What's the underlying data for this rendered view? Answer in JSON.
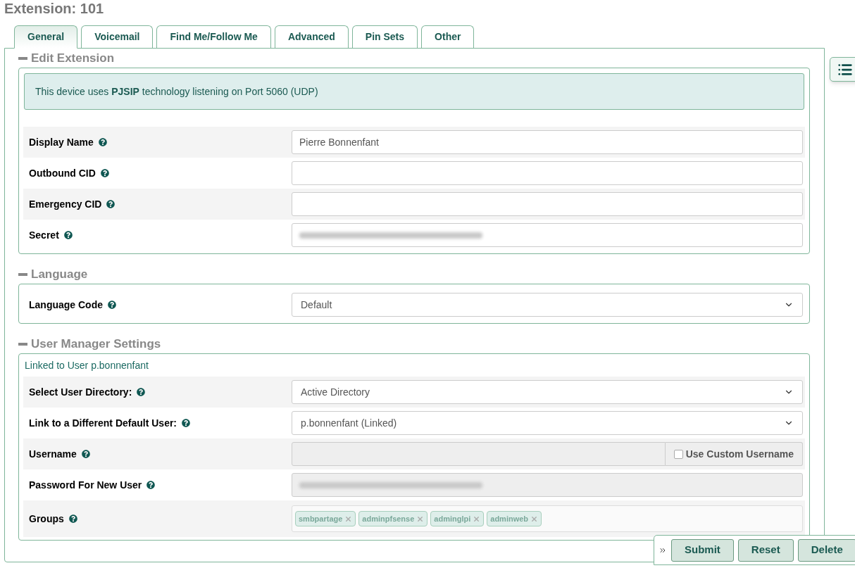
{
  "page_title": "Extension: 101",
  "tabs": [
    {
      "label": "General",
      "selected": true
    },
    {
      "label": "Voicemail",
      "selected": false
    },
    {
      "label": "Find Me/Follow Me",
      "selected": false
    },
    {
      "label": "Advanced",
      "selected": false
    },
    {
      "label": "Pin Sets",
      "selected": false
    },
    {
      "label": "Other",
      "selected": false
    }
  ],
  "sections": [
    {
      "title": "Edit Extension",
      "expanded": true,
      "notice": "This device uses **PJSIP** technology listening on Port 5060 (UDP)",
      "rows": [
        {
          "kind": "text",
          "label": "Display Name",
          "value": "Pierre Bonnenfant",
          "disabled": false
        },
        {
          "kind": "text",
          "label": "Outbound CID",
          "disabled": false
        },
        {
          "kind": "text",
          "label": "Emergency CID",
          "disabled": false
        },
        {
          "kind": "text",
          "label": "Secret",
          "disabled": false,
          "redacted": true
        }
      ]
    },
    {
      "title": "Language",
      "expanded": true,
      "rows": [
        {
          "kind": "select",
          "label": "Language Code",
          "value": "Default"
        }
      ]
    },
    {
      "title": "User Manager Settings",
      "expanded": true,
      "linked_note": "Linked to User p.bonnenfant",
      "rows": [
        {
          "kind": "select",
          "label": "Select User Directory:",
          "value": "Active Directory"
        },
        {
          "kind": "select",
          "label": "Link to a Different Default User:",
          "value": "p.bonnenfant (Linked)"
        },
        {
          "kind": "username",
          "label": "Username",
          "disabled": true,
          "checkbox": {
            "label": "Use Custom Username",
            "checked": false
          }
        },
        {
          "kind": "text",
          "label": "Password For New User",
          "disabled": true,
          "redacted": true
        },
        {
          "kind": "tags",
          "label": "Groups",
          "tags": [
            "smbpartage",
            "adminpfsense",
            "adminglpi",
            "adminweb"
          ]
        }
      ]
    }
  ],
  "actions": [
    "Submit",
    "Reset",
    "Delete"
  ]
}
